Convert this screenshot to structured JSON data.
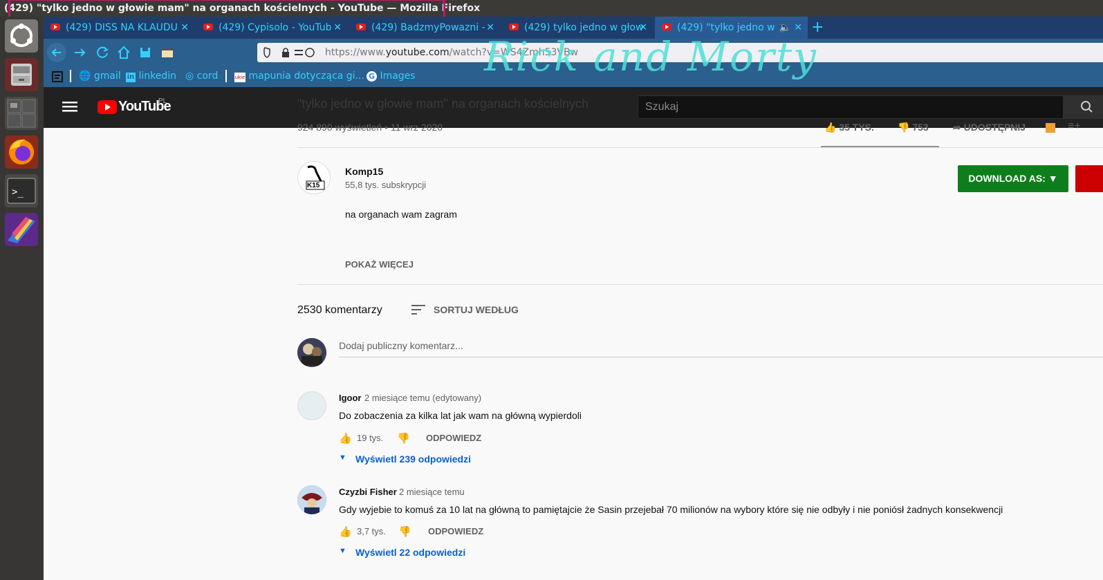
{
  "window": {
    "title": "(429) \"tylko jedno w głowie mam\" na organach kościelnych - YouTube — Mozilla Firefox"
  },
  "tabs": [
    {
      "label": "(429) DISS NA KLAUDU"
    },
    {
      "label": "(429) Cypisolo - YouTub"
    },
    {
      "label": "(429) BadzmyPowazni -"
    },
    {
      "label": "(429) tylko jedno w głow"
    },
    {
      "label": "(429) \"tylko jedno w"
    }
  ],
  "navigation": {
    "url_prefix": "https://www.",
    "url_domain": "youtube.com",
    "url_suffix": "/watch?v=WS4Zmh53VBw"
  },
  "bookmarks": [
    {
      "label": "gmail"
    },
    {
      "label": "linkedin"
    },
    {
      "label": "cord"
    },
    {
      "label": "mapunia dotycząca gi..."
    },
    {
      "label": "Images"
    }
  ],
  "background_art": {
    "text": "Rick and Morty"
  },
  "youtube": {
    "logo_text": "YouTube",
    "region": "PL",
    "search_placeholder": "Szukaj",
    "video_title": "\"tylko jedno w głowie mam\" na organach kościelnych",
    "views_date": "924 890 wyświetleń • 11 wrz 2020",
    "likes": "35 TYS.",
    "dislikes": "753",
    "share_label": "UDOSTĘPNIJ"
  },
  "channel": {
    "name": "Komp15",
    "subscribers": "55,8 tys. subskrypcji",
    "avatar_text": "K15",
    "description": "na organach wam zagram",
    "show_more": "POKAŻ WIĘCEJ",
    "download_label": "DOWNLOAD AS: ▼"
  },
  "comments": {
    "count_label": "2530 komentarzy",
    "sort_label": "SORTUJ WEDŁUG",
    "add_placeholder": "Dodaj publiczny komentarz...",
    "items": [
      {
        "author": "Igoor",
        "meta": "2 miesiące temu (edytowany)",
        "text": "Do zobaczenia za kilka lat jak wam na główną wypierdoli",
        "likes": "19 tys.",
        "reply": "ODPOWIEDZ",
        "replies": "Wyświetl 239 odpowiedzi"
      },
      {
        "author": "Czyzbi Fisher",
        "meta": "2 miesiące temu",
        "text": "Gdy wyjebie to komuś za 10 lat na główną to pamiętajcie że Sasin przejebał 70 milionów na wybory które się nie odbyły i nie poniósł żadnych konsekwencji",
        "likes": "3,7 tys.",
        "reply": "ODPOWIEDZ",
        "replies": "Wyświetl 22 odpowiedzi"
      }
    ]
  }
}
